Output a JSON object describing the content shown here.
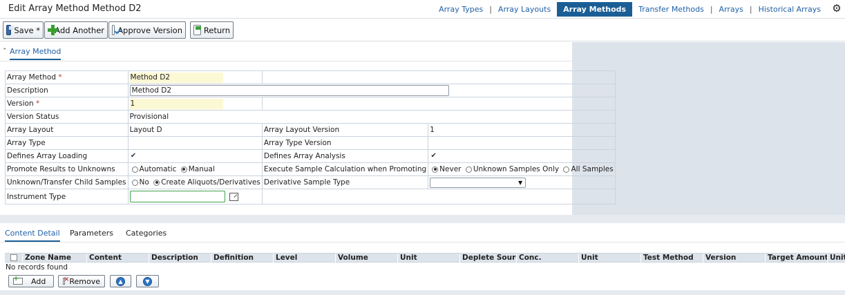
{
  "header": {
    "title": "Edit Array Method Method D2",
    "nav": [
      "Array Types",
      "Array Layouts",
      "Array Methods",
      "Transfer Methods",
      "Arrays",
      "Historical Arrays"
    ],
    "active_nav": "Array Methods",
    "settings_icon": "gear-icon"
  },
  "toolbar": {
    "save_label": "Save *",
    "add_another_label": "Add Another",
    "approve_label": "Approve Version",
    "return_label": "Return"
  },
  "section": {
    "label": "Array Method"
  },
  "form": {
    "array_method_label": "Array Method",
    "array_method_value": "Method D2",
    "description_label": "Description",
    "description_value": "Method D2",
    "version_label": "Version",
    "version_value": "1",
    "required_mark": "*",
    "version_status_label": "Version Status",
    "version_status_value": "Provisional",
    "array_layout_label": "Array Layout",
    "array_layout_value": "Layout D",
    "array_layout_version_label": "Array Layout Version",
    "array_layout_version_value": "1",
    "array_type_label": "Array Type",
    "array_type_value": "",
    "array_type_version_label": "Array Type Version",
    "array_type_version_value": "",
    "defines_loading_label": "Defines Array Loading",
    "defines_loading_checked": true,
    "defines_analysis_label": "Defines Array Analysis",
    "defines_analysis_checked": true,
    "promote_label": "Promote Results to Unknowns",
    "promote_options": [
      "Automatic",
      "Manual"
    ],
    "promote_selected": "Manual",
    "exec_calc_label": "Execute Sample Calculation when Promoting",
    "exec_calc_options": [
      "Never",
      "Unknown Samples Only",
      "All Samples"
    ],
    "exec_calc_selected": "Never",
    "child_samples_label": "Unknown/Transfer Child Samples",
    "child_samples_options": [
      "No",
      "Create Aliquots/Derivatives"
    ],
    "child_samples_selected": "Create Aliquots/Derivatives",
    "derivative_type_label": "Derivative Sample Type",
    "derivative_type_value": "",
    "instrument_type_label": "Instrument Type",
    "instrument_type_value": ""
  },
  "lower_tabs": [
    "Content Detail",
    "Parameters",
    "Categories"
  ],
  "active_lower_tab": "Content Detail",
  "grid": {
    "columns": [
      "Zone Name",
      "Content",
      "Description",
      "Definition",
      "Level",
      "Volume",
      "Unit",
      "Deplete Source",
      "Conc.",
      "Unit",
      "Test Method",
      "Version",
      "Target Amount",
      "Unit"
    ],
    "empty_text": "No records found",
    "add_label": "Add",
    "remove_label": "Remove"
  }
}
